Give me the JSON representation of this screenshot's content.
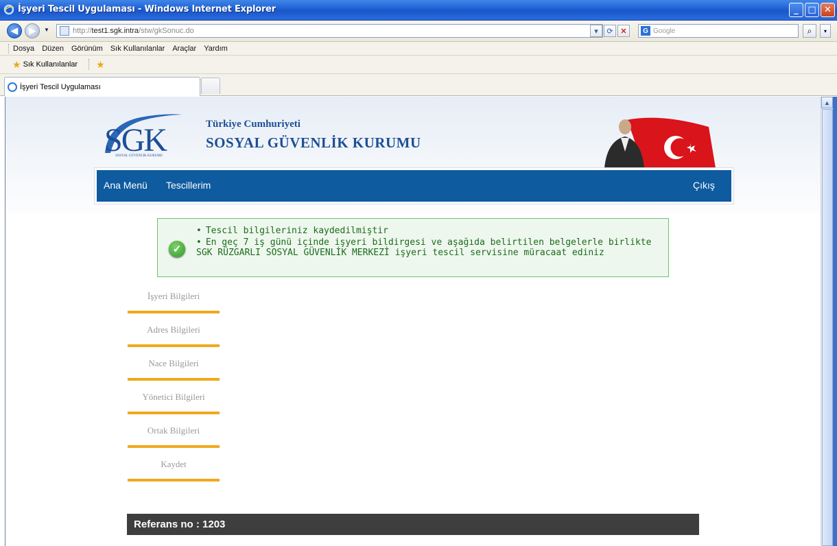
{
  "window": {
    "title": "İşyeri Tescil Uygulaması - Windows Internet Explorer",
    "controls": {
      "minimize": "_",
      "maximize": "□",
      "close": "✕"
    }
  },
  "address": {
    "url_scheme": "http://",
    "url_host": "test1.sgk.intra",
    "url_path": "/stw/gkSonuc.do",
    "search_placeholder": "Google",
    "search_engine_icon": "G"
  },
  "menu": [
    "Dosya",
    "Düzen",
    "Görünüm",
    "Sık Kullanılanlar",
    "Araçlar",
    "Yardım"
  ],
  "favorites": {
    "label": "Sık Kullanılanlar"
  },
  "tab": {
    "label": "İşyeri Tescil Uygulaması"
  },
  "header": {
    "logo_text": "SGK",
    "logo_subtext": "SOSYAL GÜVENLİK KURUMU",
    "org_line1": "Türkiye Cumhuriyeti",
    "org_line2": "SOSYAL GÜVENLİK KURUMU"
  },
  "nav": {
    "home": "Ana Menü",
    "registrations": "Tescillerim",
    "logout": "Çıkış"
  },
  "message": {
    "line1": "Tescil bilgileriniz kaydedilmiştir",
    "line2": "En geç 7 iş günü içinde işyeri bildirgesi ve aşağıda belirtilen belgelerle birlikte SGK RÜZGARLI SOSYAL GÜVENLİK MERKEZİ işyeri tescil servisine müracaat ediniz",
    "bullet": "•"
  },
  "steps": [
    {
      "label": "İşyeri Bilgileri"
    },
    {
      "label": "Adres Bilgileri"
    },
    {
      "label": "Nace Bilgileri"
    },
    {
      "label": "Yönetici Bilgileri"
    },
    {
      "label": "Ortak Bilgileri"
    },
    {
      "label": "Kaydet"
    }
  ],
  "reference": {
    "text": "Referans no : 1203"
  },
  "colors": {
    "nav_bg": "#0f5b9f",
    "step_bar": "#f0a91c",
    "message_text": "#1b6b1b",
    "reference_bg": "#3e3e3e"
  }
}
